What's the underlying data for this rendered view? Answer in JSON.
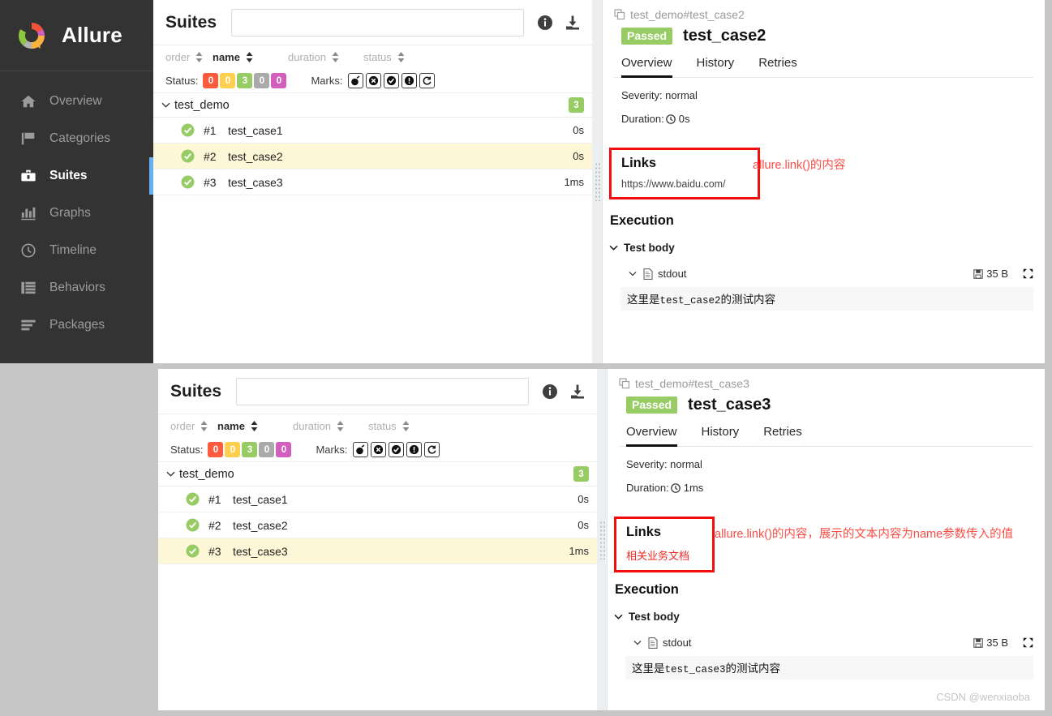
{
  "sidebar": {
    "brand": "Allure",
    "items": [
      {
        "label": "Overview",
        "icon": "home-icon",
        "active": false
      },
      {
        "label": "Categories",
        "icon": "flag-icon",
        "active": false
      },
      {
        "label": "Suites",
        "icon": "suitcase-icon",
        "active": true
      },
      {
        "label": "Graphs",
        "icon": "bar-chart-icon",
        "active": false
      },
      {
        "label": "Timeline",
        "icon": "clock-icon",
        "active": false
      },
      {
        "label": "Behaviors",
        "icon": "list-icon",
        "active": false
      },
      {
        "label": "Packages",
        "icon": "stack-icon",
        "active": false
      }
    ]
  },
  "suites_panel": {
    "title": "Suites",
    "search_value": "",
    "search_placeholder": "",
    "info_icon": "info-icon",
    "download_icon": "download-icon",
    "sort": [
      {
        "label": "order",
        "active": false
      },
      {
        "label": "name",
        "active": true
      },
      {
        "label": "duration",
        "active": false
      },
      {
        "label": "status",
        "active": false
      }
    ],
    "status_label": "Status:",
    "status_chips": [
      {
        "count": "0",
        "color": "#fd5a3e",
        "name": "failed"
      },
      {
        "count": "0",
        "color": "#ffd050",
        "name": "broken"
      },
      {
        "count": "3",
        "color": "#97cc64",
        "name": "passed"
      },
      {
        "count": "0",
        "color": "#aaaaaa",
        "name": "skipped"
      },
      {
        "count": "0",
        "color": "#d35ebe",
        "name": "unknown"
      }
    ],
    "marks_label": "Marks:",
    "marks": [
      "bomb-icon",
      "x-circle-icon",
      "check-circle-icon",
      "exclamation-circle-icon",
      "retry-icon"
    ],
    "suite": {
      "name": "test_demo",
      "count": "3"
    },
    "cases": [
      {
        "num": "#1",
        "name": "test_case1",
        "duration": "0s",
        "status": "passed"
      },
      {
        "num": "#2",
        "name": "test_case2",
        "duration": "0s",
        "status": "passed"
      },
      {
        "num": "#3",
        "name": "test_case3",
        "duration": "1ms",
        "status": "passed"
      }
    ]
  },
  "detail_top": {
    "breadcrumb": "test_demo#test_case2",
    "status_badge": "Passed",
    "title": "test_case2",
    "tabs": [
      {
        "label": "Overview",
        "active": true
      },
      {
        "label": "History",
        "active": false
      },
      {
        "label": "Retries",
        "active": false
      }
    ],
    "severity": "Severity: normal",
    "duration_label": "Duration:",
    "duration_value": "0s",
    "links_title": "Links",
    "link_value": "https://www.baidu.com/",
    "annotation": "allure.link()的内容",
    "execution_title": "Execution",
    "test_body": "Test body",
    "attachment_name": "stdout",
    "attachment_size": "35 B",
    "stdout_prefix": "这里是",
    "stdout_mono": "test_case2",
    "stdout_suffix": "的测试内容"
  },
  "detail_bottom": {
    "breadcrumb": "test_demo#test_case3",
    "status_badge": "Passed",
    "title": "test_case3",
    "tabs": [
      {
        "label": "Overview",
        "active": true
      },
      {
        "label": "History",
        "active": false
      },
      {
        "label": "Retries",
        "active": false
      }
    ],
    "severity": "Severity: normal",
    "duration_label": "Duration:",
    "duration_value": "1ms",
    "links_title": "Links",
    "link_value": "相关业务文档",
    "annotation": "allure.link()的内容，展示的文本内容为name参数传入的值",
    "execution_title": "Execution",
    "test_body": "Test body",
    "attachment_name": "stdout",
    "attachment_size": "35 B",
    "stdout_prefix": "这里是",
    "stdout_mono": "test_case3",
    "stdout_suffix": "的测试内容"
  },
  "watermark": "CSDN @wenxiaoba",
  "colors": {
    "sidebar_bg": "#333333",
    "active_bar": "#63b0f5",
    "passed_green": "#97cc64",
    "selected_row": "#fdf7d7",
    "annotation_red": "#fb4c46",
    "box_red": "#f40d0d",
    "page_bg": "#c6c6c6"
  }
}
